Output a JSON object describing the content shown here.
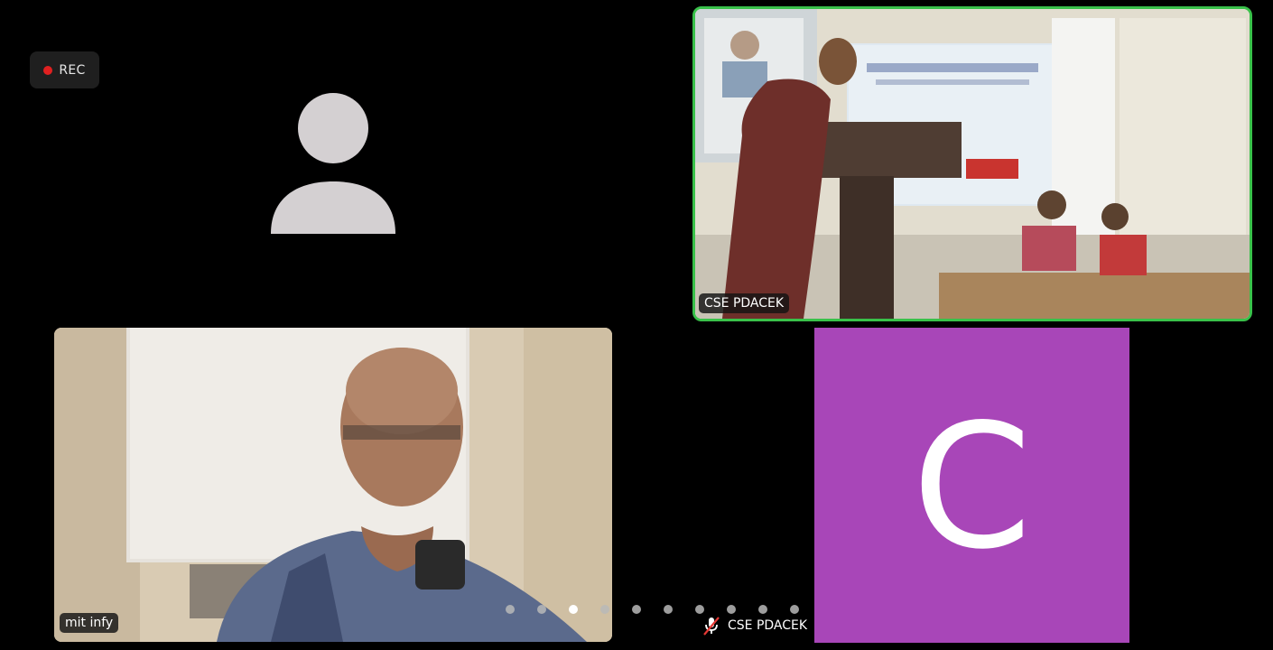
{
  "recording": {
    "label": "REC"
  },
  "participants": {
    "speaker": {
      "name": "CSE PDACEK"
    },
    "mit": {
      "name": "mit infy"
    },
    "c_tile": {
      "name": "CSE PDACEK",
      "initial": "C",
      "color": "#a846b8",
      "muted": true
    }
  },
  "pagination": {
    "total": 10,
    "active": 2
  },
  "colors": {
    "active_speaker_border": "#39c14a",
    "rec_dot": "#e02020"
  }
}
